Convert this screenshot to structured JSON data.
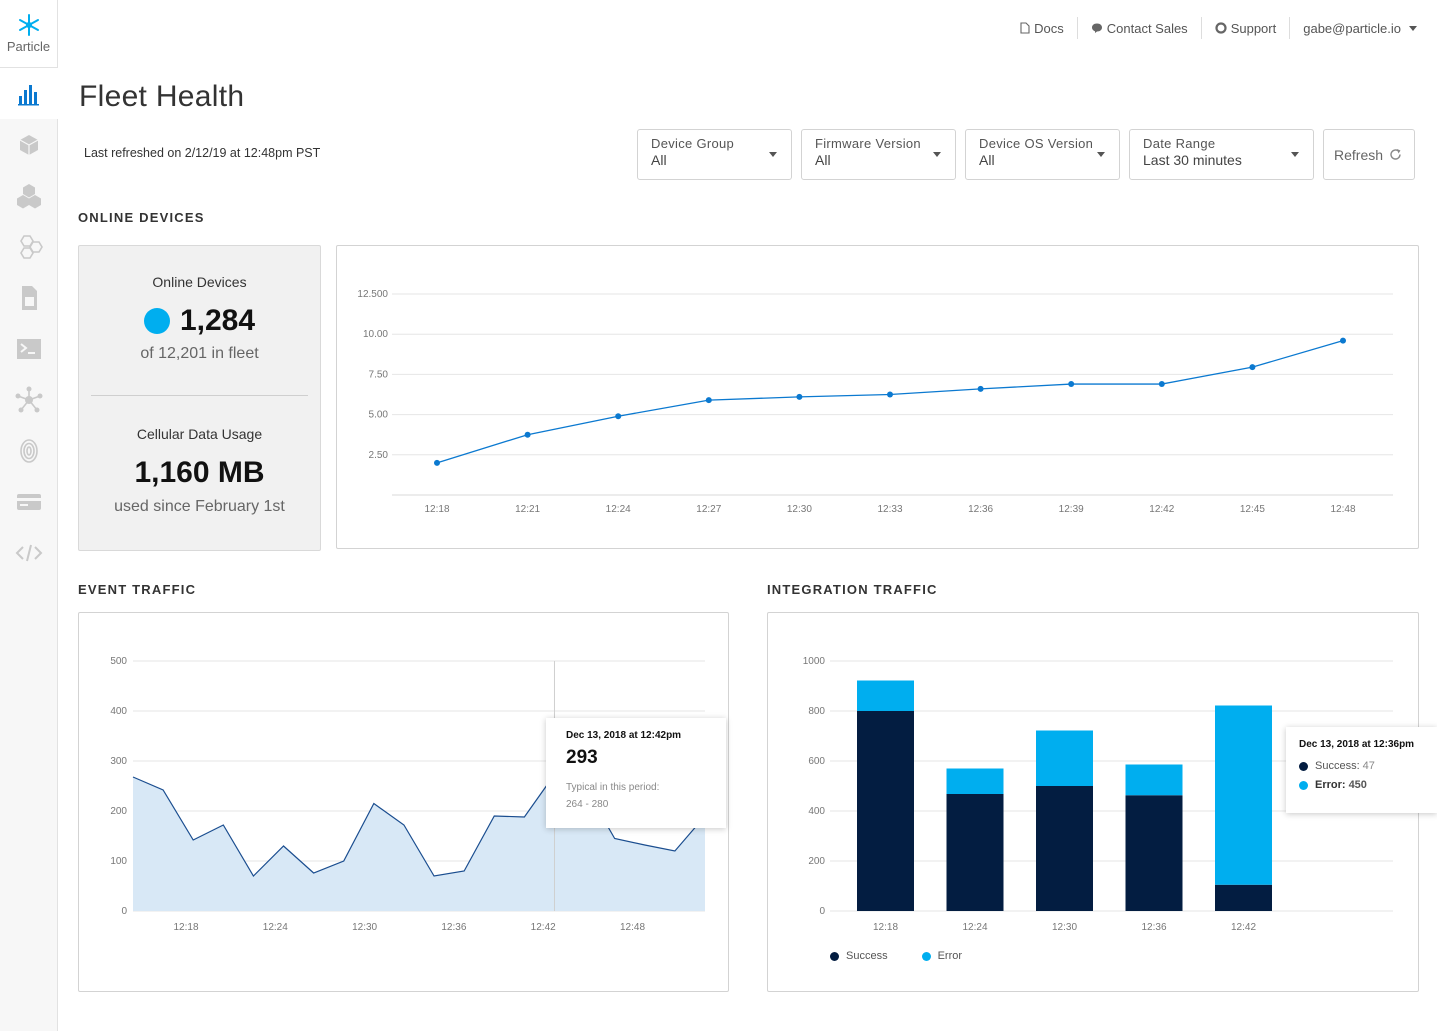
{
  "brand": {
    "name": "Particle",
    "accent": "#00aeef",
    "dark": "#031d41"
  },
  "sidebar": {
    "items": [
      {
        "name": "analytics",
        "icon": "bar-chart-icon",
        "active": true
      },
      {
        "name": "devices",
        "icon": "cube-icon"
      },
      {
        "name": "products",
        "icon": "cubes-icon"
      },
      {
        "name": "mesh",
        "icon": "hexagons-icon"
      },
      {
        "name": "sim-cards",
        "icon": "sim-card-icon"
      },
      {
        "name": "console",
        "icon": "terminal-icon"
      },
      {
        "name": "integrations",
        "icon": "network-icon"
      },
      {
        "name": "authentication",
        "icon": "fingerprint-icon"
      },
      {
        "name": "billing",
        "icon": "credit-card-icon"
      },
      {
        "name": "code",
        "icon": "code-icon"
      }
    ]
  },
  "topnav": {
    "docs": "Docs",
    "contact_sales": "Contact Sales",
    "support": "Support",
    "user": "gabe@particle.io"
  },
  "page": {
    "title": "Fleet Health",
    "last_refreshed": "Last refreshed on 2/12/19 at 12:48pm PST"
  },
  "filters": {
    "device_group": {
      "label": "Device Group",
      "value": "All"
    },
    "firmware_version": {
      "label": "Firmware Version",
      "value": "All"
    },
    "device_os_version": {
      "label": "Device OS Version",
      "value": "All"
    },
    "date_range": {
      "label": "Date Range",
      "value": "Last 30 minutes"
    },
    "refresh": "Refresh"
  },
  "sections": {
    "online_devices": "ONLINE DEVICES",
    "event_traffic": "EVENT TRAFFIC",
    "integration_traffic": "INTEGRATION TRAFFIC"
  },
  "stats": {
    "online_title": "Online Devices",
    "online_value": "1,284",
    "online_sub": "of 12,201 in fleet",
    "cellular_title": "Cellular Data Usage",
    "cellular_value": "1,160 MB",
    "cellular_sub": "used since February 1st"
  },
  "chart_data": [
    {
      "id": "online-devices",
      "type": "line",
      "x": [
        "12:18",
        "12:21",
        "12:24",
        "12:27",
        "12:30",
        "12:33",
        "12:36",
        "12:39",
        "12:42",
        "12:45",
        "12:48"
      ],
      "values": [
        2.0,
        3.75,
        4.9,
        5.9,
        6.1,
        6.25,
        6.6,
        6.9,
        6.9,
        7.95,
        9.6
      ],
      "yticks": [
        2.5,
        5.0,
        7.5,
        10.0,
        12.5
      ],
      "ytick_labels": [
        "2.50",
        "5.00",
        "7.50",
        "10.00",
        "12.500"
      ],
      "ylim": [
        0,
        12.5
      ],
      "grid": true,
      "color": "#0b79d0"
    },
    {
      "id": "event-traffic",
      "type": "area",
      "values": [
        268,
        242,
        142,
        172,
        70,
        130,
        76,
        100,
        215,
        172,
        70,
        80,
        190,
        188,
        273,
        250,
        145,
        132,
        120,
        190
      ],
      "xticks": [
        "12:18",
        "12:24",
        "12:30",
        "12:36",
        "12:42",
        "12:48"
      ],
      "ylim": [
        0,
        500
      ],
      "yticks": [
        0,
        100,
        200,
        300,
        400,
        500
      ],
      "grid": true,
      "color": "#1a4d8f",
      "fill": "#d8e8f6",
      "highlight_index": 14,
      "tooltip": {
        "date": "Dec 13, 2018 at 12:42pm",
        "value": "293",
        "typical_label": "Typical in this period:",
        "typical_range": "264 - 280"
      }
    },
    {
      "id": "integration-traffic",
      "type": "bar",
      "categories": [
        "12:18",
        "12:24",
        "12:30",
        "12:36",
        "12:42"
      ],
      "series": [
        {
          "name": "Success",
          "values": [
            800,
            468,
            500,
            463,
            105
          ],
          "color": "#031d41"
        },
        {
          "name": "Error",
          "values": [
            122,
            102,
            222,
            123,
            717
          ],
          "color": "#00aeef"
        }
      ],
      "ylim": [
        0,
        1000
      ],
      "yticks": [
        0,
        200,
        400,
        600,
        800,
        1000
      ],
      "grid": true,
      "tooltip": {
        "date": "Dec 13, 2018 at 12:36pm",
        "success_label": "Success:",
        "success_value": "47",
        "error_label": "Error:",
        "error_value": "450"
      }
    }
  ]
}
